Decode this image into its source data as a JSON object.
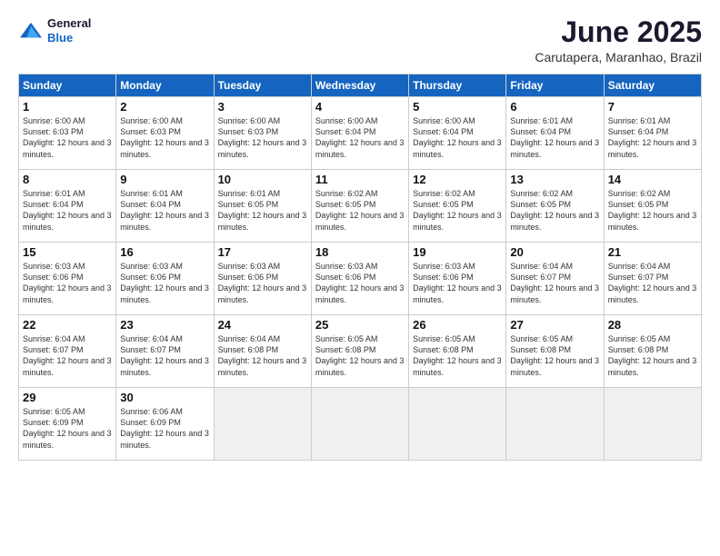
{
  "logo": {
    "line1": "General",
    "line2": "Blue"
  },
  "title": "June 2025",
  "subtitle": "Carutapera, Maranhao, Brazil",
  "weekdays": [
    "Sunday",
    "Monday",
    "Tuesday",
    "Wednesday",
    "Thursday",
    "Friday",
    "Saturday"
  ],
  "weeks": [
    [
      {
        "day": "1",
        "sunrise": "6:00 AM",
        "sunset": "6:03 PM",
        "daylight": "12 hours and 3 minutes."
      },
      {
        "day": "2",
        "sunrise": "6:00 AM",
        "sunset": "6:03 PM",
        "daylight": "12 hours and 3 minutes."
      },
      {
        "day": "3",
        "sunrise": "6:00 AM",
        "sunset": "6:03 PM",
        "daylight": "12 hours and 3 minutes."
      },
      {
        "day": "4",
        "sunrise": "6:00 AM",
        "sunset": "6:04 PM",
        "daylight": "12 hours and 3 minutes."
      },
      {
        "day": "5",
        "sunrise": "6:00 AM",
        "sunset": "6:04 PM",
        "daylight": "12 hours and 3 minutes."
      },
      {
        "day": "6",
        "sunrise": "6:01 AM",
        "sunset": "6:04 PM",
        "daylight": "12 hours and 3 minutes."
      },
      {
        "day": "7",
        "sunrise": "6:01 AM",
        "sunset": "6:04 PM",
        "daylight": "12 hours and 3 minutes."
      }
    ],
    [
      {
        "day": "8",
        "sunrise": "6:01 AM",
        "sunset": "6:04 PM",
        "daylight": "12 hours and 3 minutes."
      },
      {
        "day": "9",
        "sunrise": "6:01 AM",
        "sunset": "6:04 PM",
        "daylight": "12 hours and 3 minutes."
      },
      {
        "day": "10",
        "sunrise": "6:01 AM",
        "sunset": "6:05 PM",
        "daylight": "12 hours and 3 minutes."
      },
      {
        "day": "11",
        "sunrise": "6:02 AM",
        "sunset": "6:05 PM",
        "daylight": "12 hours and 3 minutes."
      },
      {
        "day": "12",
        "sunrise": "6:02 AM",
        "sunset": "6:05 PM",
        "daylight": "12 hours and 3 minutes."
      },
      {
        "day": "13",
        "sunrise": "6:02 AM",
        "sunset": "6:05 PM",
        "daylight": "12 hours and 3 minutes."
      },
      {
        "day": "14",
        "sunrise": "6:02 AM",
        "sunset": "6:05 PM",
        "daylight": "12 hours and 3 minutes."
      }
    ],
    [
      {
        "day": "15",
        "sunrise": "6:03 AM",
        "sunset": "6:06 PM",
        "daylight": "12 hours and 3 minutes."
      },
      {
        "day": "16",
        "sunrise": "6:03 AM",
        "sunset": "6:06 PM",
        "daylight": "12 hours and 3 minutes."
      },
      {
        "day": "17",
        "sunrise": "6:03 AM",
        "sunset": "6:06 PM",
        "daylight": "12 hours and 3 minutes."
      },
      {
        "day": "18",
        "sunrise": "6:03 AM",
        "sunset": "6:06 PM",
        "daylight": "12 hours and 3 minutes."
      },
      {
        "day": "19",
        "sunrise": "6:03 AM",
        "sunset": "6:06 PM",
        "daylight": "12 hours and 3 minutes."
      },
      {
        "day": "20",
        "sunrise": "6:04 AM",
        "sunset": "6:07 PM",
        "daylight": "12 hours and 3 minutes."
      },
      {
        "day": "21",
        "sunrise": "6:04 AM",
        "sunset": "6:07 PM",
        "daylight": "12 hours and 3 minutes."
      }
    ],
    [
      {
        "day": "22",
        "sunrise": "6:04 AM",
        "sunset": "6:07 PM",
        "daylight": "12 hours and 3 minutes."
      },
      {
        "day": "23",
        "sunrise": "6:04 AM",
        "sunset": "6:07 PM",
        "daylight": "12 hours and 3 minutes."
      },
      {
        "day": "24",
        "sunrise": "6:04 AM",
        "sunset": "6:08 PM",
        "daylight": "12 hours and 3 minutes."
      },
      {
        "day": "25",
        "sunrise": "6:05 AM",
        "sunset": "6:08 PM",
        "daylight": "12 hours and 3 minutes."
      },
      {
        "day": "26",
        "sunrise": "6:05 AM",
        "sunset": "6:08 PM",
        "daylight": "12 hours and 3 minutes."
      },
      {
        "day": "27",
        "sunrise": "6:05 AM",
        "sunset": "6:08 PM",
        "daylight": "12 hours and 3 minutes."
      },
      {
        "day": "28",
        "sunrise": "6:05 AM",
        "sunset": "6:08 PM",
        "daylight": "12 hours and 3 minutes."
      }
    ],
    [
      {
        "day": "29",
        "sunrise": "6:05 AM",
        "sunset": "6:09 PM",
        "daylight": "12 hours and 3 minutes."
      },
      {
        "day": "30",
        "sunrise": "6:06 AM",
        "sunset": "6:09 PM",
        "daylight": "12 hours and 3 minutes."
      },
      null,
      null,
      null,
      null,
      null
    ]
  ]
}
